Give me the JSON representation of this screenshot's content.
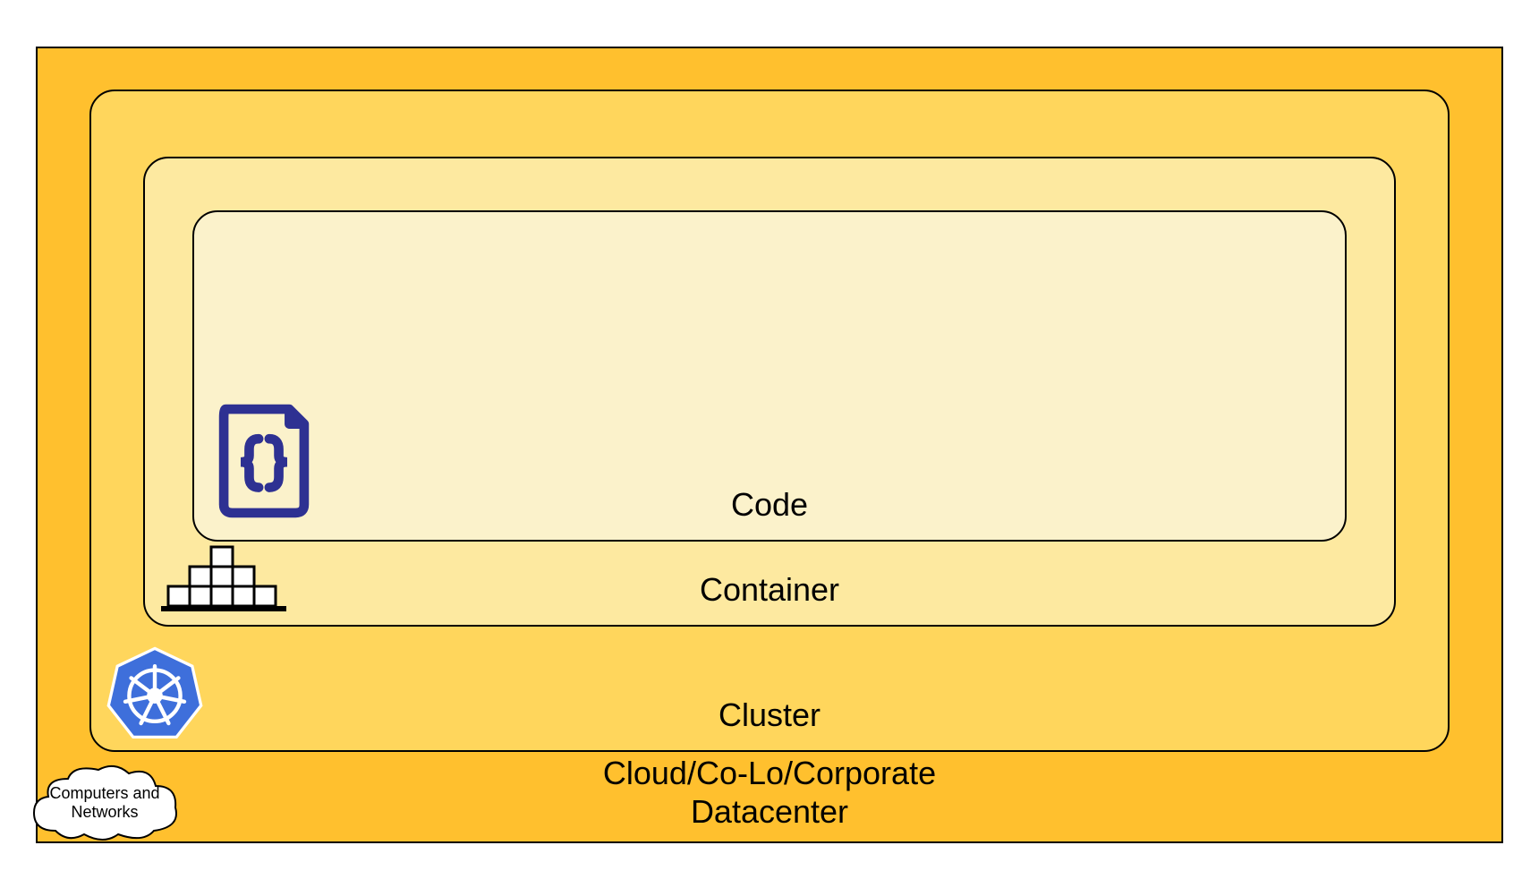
{
  "layers": {
    "datacenter": {
      "label": "Cloud/Co-Lo/Corporate\nDatacenter",
      "icon_name": "cloud-icon",
      "icon_caption": "Computers and\nNetworks",
      "fill": "#FFC02E"
    },
    "cluster": {
      "label": "Cluster",
      "icon_name": "kubernetes-icon",
      "fill": "#FFD65C"
    },
    "container": {
      "label": "Container",
      "icon_name": "docker-containers-icon",
      "fill": "#FDE9A0"
    },
    "code": {
      "label": "Code",
      "icon_name": "code-file-icon",
      "fill": "#FBF2CB"
    }
  },
  "colors": {
    "border": "#000000",
    "icon_primary": "#2E3192",
    "k8s_blue": "#3E6FDB"
  }
}
